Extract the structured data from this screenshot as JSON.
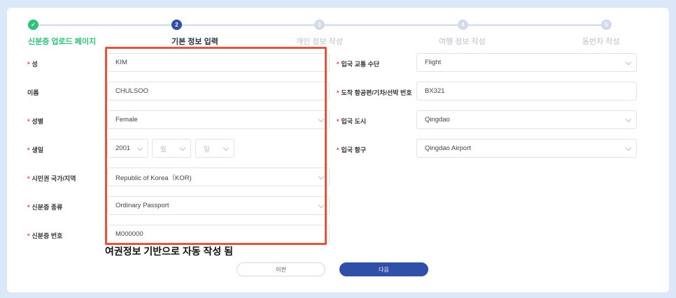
{
  "steps": [
    {
      "num": "✓",
      "label": "신분증 업로드 페이지"
    },
    {
      "num": "2",
      "label": "기본 정보 입력"
    },
    {
      "num": "3",
      "label": "개인 정보 작성"
    },
    {
      "num": "4",
      "label": "여행 정보 작성"
    },
    {
      "num": "5",
      "label": "동반자 작성"
    }
  ],
  "form": {
    "surname": {
      "label": "성",
      "value": "KIM"
    },
    "given_name": {
      "label": "이름",
      "value": "CHULSOO"
    },
    "gender": {
      "label": "성별",
      "value": "Female"
    },
    "birthday": {
      "label": "생일",
      "year": "2001",
      "month_placeholder": "월",
      "day_placeholder": "일"
    },
    "nationality": {
      "label": "시민권 국가/지역",
      "value": "Republic of Korea（KOR)"
    },
    "id_type": {
      "label": "신분증 종류",
      "value": "Ordinary Passport"
    },
    "id_number": {
      "label": "신분증 번호",
      "value": "M000000"
    },
    "transport": {
      "label": "입국 교통 수단",
      "value": "Flight"
    },
    "flight_no": {
      "label": "도착 항공편/기차/선박 번호",
      "value": "BX321"
    },
    "entry_city": {
      "label": "입국 도시",
      "value": "Qingdao"
    },
    "entry_port": {
      "label": "입국 항구",
      "value": "Qingdao Airport"
    }
  },
  "annotation": "여권정보 기반으로 자동 작성 됨",
  "buttons": {
    "prev": "이전",
    "next": "다음"
  },
  "colors": {
    "accent": "#2f4fa8",
    "done": "#2fc27a",
    "highlight": "#e8543a",
    "required": "#e24a3b"
  }
}
